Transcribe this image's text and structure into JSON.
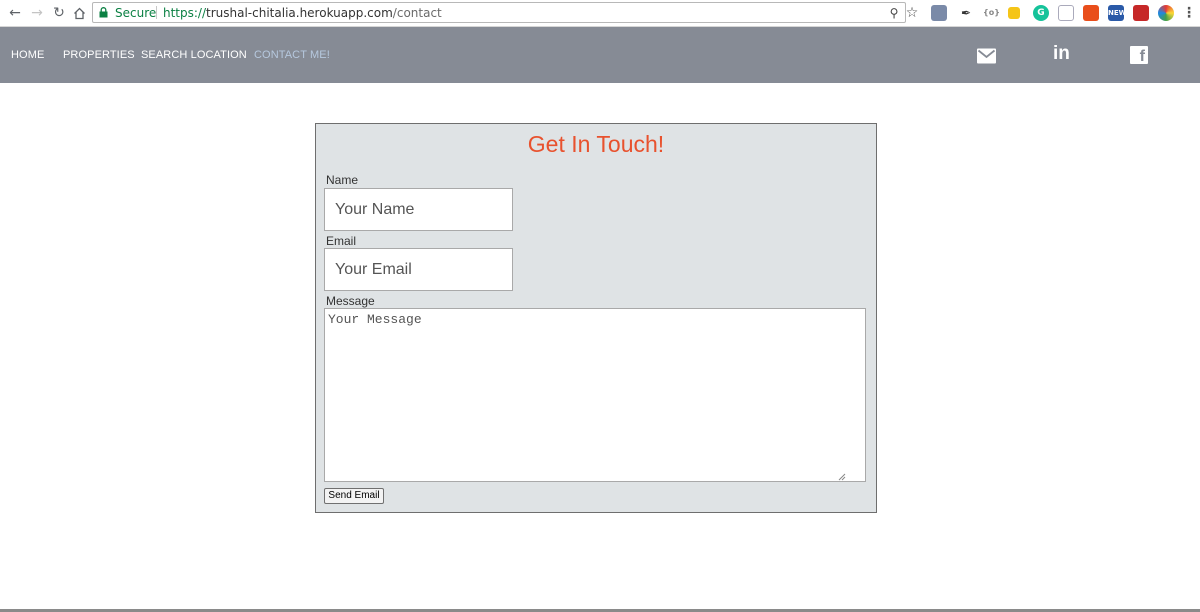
{
  "browser": {
    "back_icon": "arrow-left-icon",
    "forward_icon": "arrow-right-icon",
    "reload_icon": "reload-icon",
    "home_icon": "home-icon",
    "security_label": "Secure",
    "url_scheme": "https://",
    "url_host": "trushal-chitalia.herokuapp.com",
    "url_path": "/contact",
    "menu_icon": "vertical-dots-icon"
  },
  "navbar": {
    "links": [
      {
        "label": "HOME"
      },
      {
        "label": "PROPERTIES"
      },
      {
        "label": "SEARCH LOCATION"
      },
      {
        "label": "CONTACT ME!"
      }
    ],
    "social": [
      "email-icon",
      "linkedin-icon",
      "facebook-icon"
    ],
    "linkedin_text": "in",
    "facebook_text": "f"
  },
  "form": {
    "title": "Get In Touch!",
    "name_label": "Name",
    "name_placeholder": "Your Name",
    "email_label": "Email",
    "email_placeholder": "Your Email",
    "message_label": "Message",
    "message_placeholder": "Your Message",
    "submit_label": "Send Email"
  },
  "colors": {
    "navbar_bg": "#868b95",
    "active_link": "#b6c8de",
    "title": "#e8522e",
    "card_bg": "#dfe3e5"
  }
}
